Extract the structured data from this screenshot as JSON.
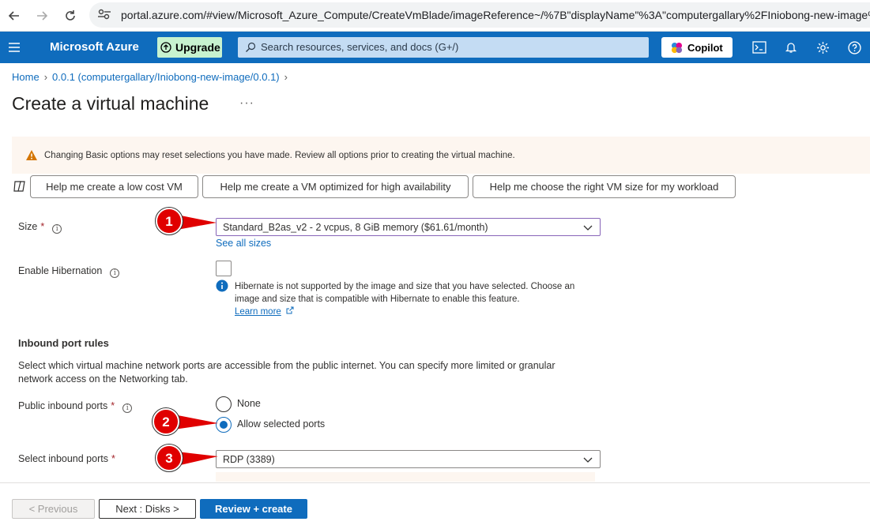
{
  "browser": {
    "url": "portal.azure.com/#view/Microsoft_Azure_Compute/CreateVmBlade/imageReference~/%7B\"displayName\"%3A\"computergallary%2FIniobong-new-image%"
  },
  "header": {
    "brand": "Microsoft Azure",
    "upgrade_label": "Upgrade",
    "search_placeholder": "Search resources, services, and docs (G+/)",
    "copilot_label": "Copilot"
  },
  "breadcrumb": {
    "home": "Home",
    "item": "0.0.1 (computergallary/Iniobong-new-image/0.0.1)"
  },
  "page": {
    "title": "Create a virtual machine",
    "more": "···"
  },
  "warning": {
    "text": "Changing Basic options may reset selections you have made. Review all options prior to creating the virtual machine."
  },
  "help_buttons": [
    "Help me create a low cost VM",
    "Help me create a VM optimized for high availability",
    "Help me choose the right VM size for my workload"
  ],
  "form": {
    "size_label": "Size",
    "size_value": "Standard_B2as_v2 - 2 vcpus, 8 GiB memory ($61.61/month)",
    "see_all_sizes": "See all sizes",
    "hibernation_label": "Enable Hibernation",
    "hibernation_checked": false,
    "hibernation_info": "Hibernate is not supported by the image and size that you have selected. Choose an image and size that is compatible with Hibernate to enable this feature.",
    "learn_more": "Learn more",
    "inbound_title": "Inbound port rules",
    "inbound_desc": "Select which virtual machine network ports are accessible from the public internet. You can specify more limited or granular network access on the Networking tab.",
    "public_ports_label": "Public inbound ports",
    "radio_none": "None",
    "radio_allow": "Allow selected ports",
    "selected_radio": "Allow selected ports",
    "select_ports_label": "Select inbound ports",
    "select_ports_value": "RDP (3389)",
    "required_mark": "*"
  },
  "footer": {
    "previous": "< Previous",
    "next": "Next : Disks >",
    "review": "Review + create"
  },
  "annotations": [
    "1",
    "2",
    "3"
  ],
  "colors": {
    "azure_blue": "#0f6cbd",
    "warning_bg": "#fdf6f0",
    "marker_red": "#e00000"
  }
}
